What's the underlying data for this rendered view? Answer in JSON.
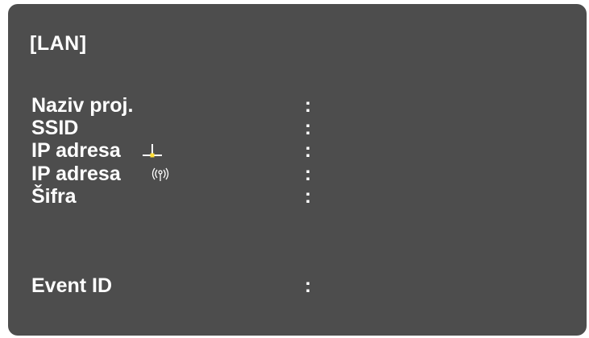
{
  "panel": {
    "title": "[LAN]",
    "rows": [
      {
        "label": "Naziv proj.",
        "separator": ":",
        "value": ""
      },
      {
        "label": "SSID",
        "separator": ":",
        "value": ""
      },
      {
        "label": "IP adresa",
        "separator": ":",
        "value": "",
        "icon": "wired-lan-icon"
      },
      {
        "label": "IP adresa",
        "separator": ":",
        "value": "",
        "icon": "wireless-lan-icon"
      },
      {
        "label": "Šifra",
        "separator": ":",
        "value": ""
      },
      {
        "label": "Event ID",
        "separator": ":",
        "value": ""
      }
    ]
  },
  "colors": {
    "background": "#4d4d4d",
    "text": "#ffffff",
    "wired_icon_accent": "#ffdd33"
  }
}
